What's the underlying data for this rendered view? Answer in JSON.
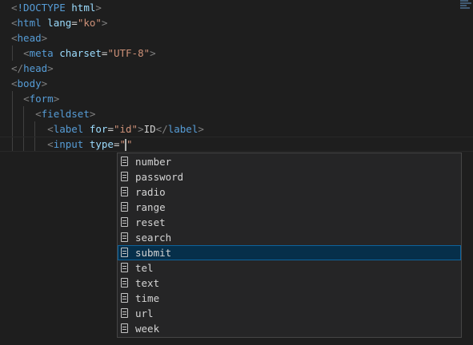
{
  "colors": {
    "background": "#1e1e1e",
    "tag": "#569cd6",
    "attribute": "#9cdcfe",
    "string": "#ce9178",
    "punctuation": "#808080",
    "text": "#d4d4d4",
    "suggest_background": "#252526",
    "suggest_selected": "#062f4a"
  },
  "code_lines": [
    [
      {
        "k": "punc",
        "v": "<"
      },
      {
        "k": "tag",
        "v": "!DOCTYPE"
      },
      {
        "k": "text",
        "v": " "
      },
      {
        "k": "attr",
        "v": "html"
      },
      {
        "k": "punc",
        "v": ">"
      }
    ],
    [
      {
        "k": "punc",
        "v": "<"
      },
      {
        "k": "tag",
        "v": "html"
      },
      {
        "k": "text",
        "v": " "
      },
      {
        "k": "attr",
        "v": "lang"
      },
      {
        "k": "text",
        "v": "="
      },
      {
        "k": "str",
        "v": "\"ko\""
      },
      {
        "k": "punc",
        "v": ">"
      }
    ],
    [
      {
        "k": "punc",
        "v": "<"
      },
      {
        "k": "tag",
        "v": "head"
      },
      {
        "k": "punc",
        "v": ">"
      }
    ],
    [
      {
        "k": "text",
        "v": "  "
      },
      {
        "k": "punc",
        "v": "<"
      },
      {
        "k": "tag",
        "v": "meta"
      },
      {
        "k": "text",
        "v": " "
      },
      {
        "k": "attr",
        "v": "charset"
      },
      {
        "k": "text",
        "v": "="
      },
      {
        "k": "str",
        "v": "\"UTF-8\""
      },
      {
        "k": "punc",
        "v": ">"
      }
    ],
    [
      {
        "k": "punc",
        "v": "</"
      },
      {
        "k": "tag",
        "v": "head"
      },
      {
        "k": "punc",
        "v": ">"
      }
    ],
    [
      {
        "k": "punc",
        "v": "<"
      },
      {
        "k": "tag",
        "v": "body"
      },
      {
        "k": "punc",
        "v": ">"
      }
    ],
    [
      {
        "k": "text",
        "v": "  "
      },
      {
        "k": "punc",
        "v": "<"
      },
      {
        "k": "tag",
        "v": "form"
      },
      {
        "k": "punc",
        "v": ">"
      }
    ],
    [
      {
        "k": "text",
        "v": "    "
      },
      {
        "k": "punc",
        "v": "<"
      },
      {
        "k": "tag",
        "v": "fieldset"
      },
      {
        "k": "punc",
        "v": ">"
      }
    ],
    [
      {
        "k": "text",
        "v": "      "
      },
      {
        "k": "punc",
        "v": "<"
      },
      {
        "k": "tag",
        "v": "label"
      },
      {
        "k": "text",
        "v": " "
      },
      {
        "k": "attr",
        "v": "for"
      },
      {
        "k": "text",
        "v": "="
      },
      {
        "k": "str",
        "v": "\"id\""
      },
      {
        "k": "punc",
        "v": ">"
      },
      {
        "k": "text",
        "v": "ID"
      },
      {
        "k": "punc",
        "v": "</"
      },
      {
        "k": "tag",
        "v": "label"
      },
      {
        "k": "punc",
        "v": ">"
      }
    ],
    [
      {
        "k": "text",
        "v": "      "
      },
      {
        "k": "punc",
        "v": "<"
      },
      {
        "k": "tag",
        "v": "input"
      },
      {
        "k": "text",
        "v": " "
      },
      {
        "k": "attr",
        "v": "type"
      },
      {
        "k": "text",
        "v": "="
      },
      {
        "k": "str",
        "v": "\"\""
      }
    ]
  ],
  "suggest": {
    "icon": "enum-value-icon",
    "selected_index": 6,
    "items": [
      "number",
      "password",
      "radio",
      "range",
      "reset",
      "search",
      "submit",
      "tel",
      "text",
      "time",
      "url",
      "week"
    ]
  }
}
